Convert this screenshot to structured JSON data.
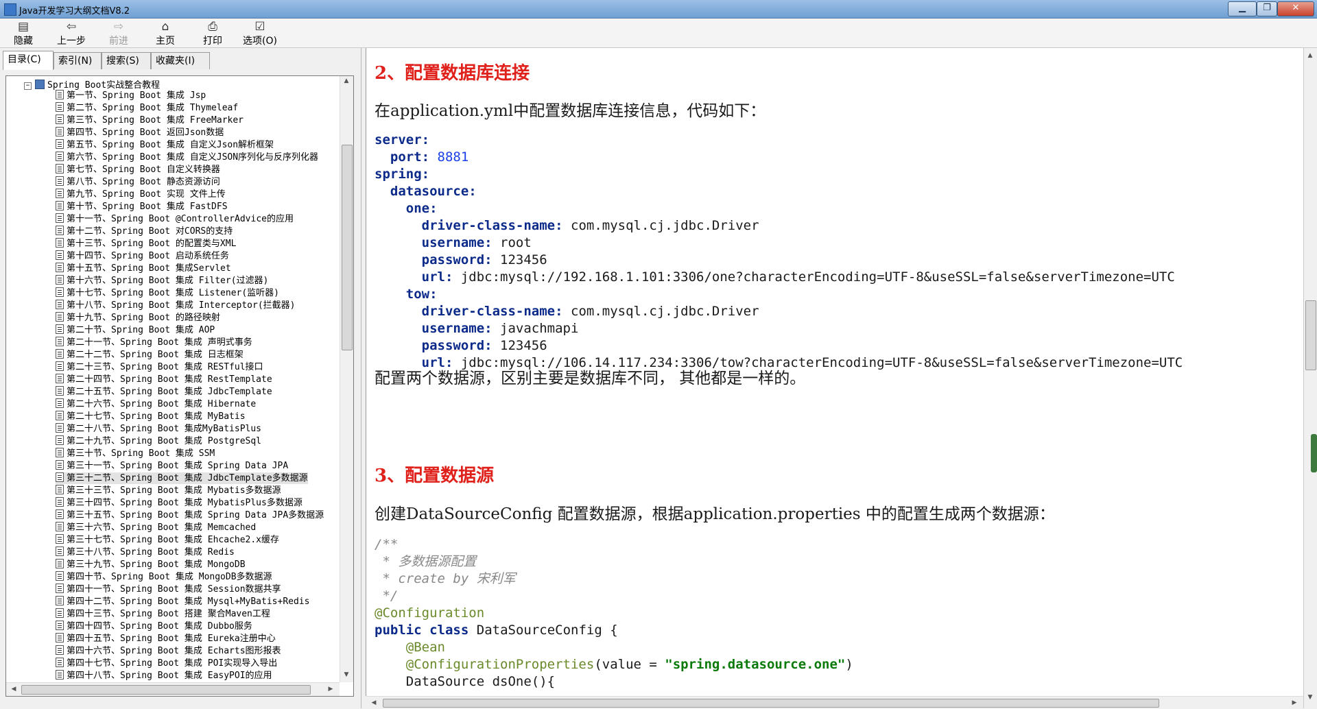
{
  "window": {
    "title": "Java开发学习大纲文档V8.2"
  },
  "toolbar": {
    "hide": "隐藏",
    "back": "上一步",
    "forward": "前进",
    "home": "主页",
    "print": "打印",
    "options": "选项(O)"
  },
  "tabs": [
    "目录(C)",
    "索引(N)",
    "搜索(S)",
    "收藏夹(I)"
  ],
  "tree": {
    "root": "Spring Boot实战整合教程",
    "items": [
      "第一节、Spring Boot 集成 Jsp",
      "第二节、Spring Boot 集成 Thymeleaf",
      "第三节、Spring Boot 集成 FreeMarker",
      "第四节、Spring Boot 返回Json数据",
      "第五节、Spring Boot 集成 自定义Json解析框架",
      "第六节、Spring Boot 集成 自定义JSON序列化与反序列化器",
      "第七节、Spring Boot 自定义转换器",
      "第八节、Spring Boot 静态资源访问",
      "第九节、Spring Boot 实现 文件上传",
      "第十节、Spring Boot 集成 FastDFS",
      "第十一节、Spring Boot @ControllerAdvice的应用",
      "第十二节、Spring Boot 对CORS的支持",
      "第十三节、Spring Boot 的配置类与XML",
      "第十四节、Spring Boot 启动系统任务",
      "第十五节、Spring Boot 集成Servlet",
      "第十六节、Spring Boot 集成 Filter(过滤器)",
      "第十七节、Spring Boot 集成 Listener(监听器)",
      "第十八节、Spring Boot 集成 Interceptor(拦截器)",
      "第十九节、Spring Boot 的路径映射",
      "第二十节、Spring Boot 集成 AOP",
      "第二十一节、Spring Boot 集成 声明式事务",
      "第二十二节、Spring Boot 集成 日志框架",
      "第二十三节、Spring Boot 集成 RESTful接口",
      "第二十四节、Spring Boot 集成 RestTemplate",
      "第二十五节、Spring Boot 集成 JdbcTemplate",
      "第二十六节、Spring Boot 集成 Hibernate",
      "第二十七节、Spring Boot 集成 MyBatis",
      "第二十八节、Spring Boot 集成MyBatisPlus",
      "第二十九节、Spring Boot 集成 PostgreSql",
      "第三十节、Spring Boot 集成 SSM",
      "第三十一节、Spring Boot 集成 Spring Data JPA",
      "第三十二节、Spring Boot 集成 JdbcTemplate多数据源",
      "第三十三节、Spring Boot 集成 Mybatis多数据源",
      "第三十四节、Spring Boot 集成 MybatisPlus多数据源",
      "第三十五节、Spring Boot 集成 Spring Data JPA多数据源",
      "第三十六节、Spring Boot 集成 Memcached",
      "第三十七节、Spring Boot 集成 Ehcache2.x缓存",
      "第三十八节、Spring Boot 集成 Redis",
      "第三十九节、Spring Boot 集成 MongoDB",
      "第四十节、Spring Boot 集成 MongoDB多数据源",
      "第四十一节、Spring Boot 集成 Session数据共享",
      "第四十二节、Spring Boot 集成 Mysql+MyBatis+Redis",
      "第四十三节、Spring Boot 搭建 聚合Maven工程",
      "第四十四节、Spring Boot 集成 Dubbo服务",
      "第四十五节、Spring Boot 集成 Eureka注册中心",
      "第四十六节、Spring Boot 集成 Echarts图形报表",
      "第四十七节、Spring Boot 集成 POI实现导入导出",
      "第四十八节、Spring Boot 集成 EasyPOI的应用"
    ],
    "selected_index": 31
  },
  "content": {
    "heading1": "2、配置数据库连接",
    "para1": "在application.yml中配置数据库连接信息，代码如下：",
    "yaml": {
      "server": "server:",
      "port_key": "port:",
      "port_val": "8881",
      "spring": "spring:",
      "datasource": "datasource:",
      "one": "one:",
      "tow": "tow:",
      "driver_key": "driver-class-name:",
      "driver_val": "com.mysql.cj.jdbc.Driver",
      "username_key": "username:",
      "password_key": "password:",
      "url_key": "url:",
      "one_username": "root",
      "one_password": "123456",
      "one_url": "jdbc:mysql://192.168.1.101:3306/one?characterEncoding=UTF-8&useSSL=false&serverTimezone=UTC",
      "tow_username": "javachmapi",
      "tow_password": "123456",
      "tow_url": "jdbc:mysql://106.14.117.234:3306/tow?characterEncoding=UTF-8&useSSL=false&serverTimezone=UTC"
    },
    "para2": "配置两个数据源，区别主要是数据库不同，  其他都是一样的。",
    "heading2": "3、配置数据源",
    "para3": "创建DataSourceConfig 配置数据源，根据application.properties 中的配置生成两个数据源：",
    "java": {
      "c1": "/**",
      "c2": " * 多数据源配置",
      "c3": " * create by 宋利军",
      "c4": " */",
      "ann_config": "@Configuration",
      "kw_public": "public",
      "kw_class": "class",
      "class_rest": "DataSourceConfig {",
      "ann_bean": "@Bean",
      "ann_props": "@ConfigurationProperties",
      "props_open": "(value = ",
      "props_str": "\"spring.datasource.one\"",
      "props_close": ")",
      "last_line": "DataSource dsOne(){"
    }
  }
}
